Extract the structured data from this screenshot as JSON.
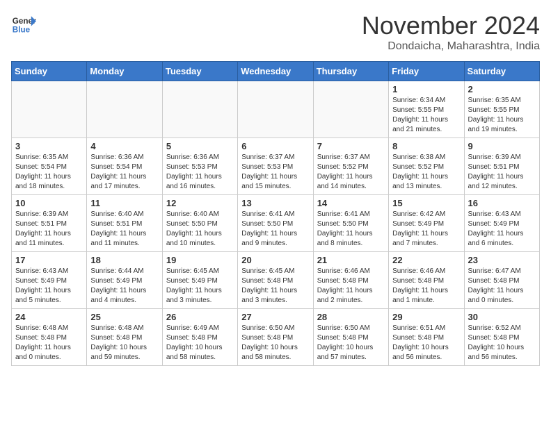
{
  "logo": {
    "line1": "General",
    "line2": "Blue"
  },
  "title": "November 2024",
  "location": "Dondaicha, Maharashtra, India",
  "weekdays": [
    "Sunday",
    "Monday",
    "Tuesday",
    "Wednesday",
    "Thursday",
    "Friday",
    "Saturday"
  ],
  "weeks": [
    [
      {
        "day": "",
        "info": ""
      },
      {
        "day": "",
        "info": ""
      },
      {
        "day": "",
        "info": ""
      },
      {
        "day": "",
        "info": ""
      },
      {
        "day": "",
        "info": ""
      },
      {
        "day": "1",
        "info": "Sunrise: 6:34 AM\nSunset: 5:55 PM\nDaylight: 11 hours and 21 minutes."
      },
      {
        "day": "2",
        "info": "Sunrise: 6:35 AM\nSunset: 5:55 PM\nDaylight: 11 hours and 19 minutes."
      }
    ],
    [
      {
        "day": "3",
        "info": "Sunrise: 6:35 AM\nSunset: 5:54 PM\nDaylight: 11 hours and 18 minutes."
      },
      {
        "day": "4",
        "info": "Sunrise: 6:36 AM\nSunset: 5:54 PM\nDaylight: 11 hours and 17 minutes."
      },
      {
        "day": "5",
        "info": "Sunrise: 6:36 AM\nSunset: 5:53 PM\nDaylight: 11 hours and 16 minutes."
      },
      {
        "day": "6",
        "info": "Sunrise: 6:37 AM\nSunset: 5:53 PM\nDaylight: 11 hours and 15 minutes."
      },
      {
        "day": "7",
        "info": "Sunrise: 6:37 AM\nSunset: 5:52 PM\nDaylight: 11 hours and 14 minutes."
      },
      {
        "day": "8",
        "info": "Sunrise: 6:38 AM\nSunset: 5:52 PM\nDaylight: 11 hours and 13 minutes."
      },
      {
        "day": "9",
        "info": "Sunrise: 6:39 AM\nSunset: 5:51 PM\nDaylight: 11 hours and 12 minutes."
      }
    ],
    [
      {
        "day": "10",
        "info": "Sunrise: 6:39 AM\nSunset: 5:51 PM\nDaylight: 11 hours and 11 minutes."
      },
      {
        "day": "11",
        "info": "Sunrise: 6:40 AM\nSunset: 5:51 PM\nDaylight: 11 hours and 11 minutes."
      },
      {
        "day": "12",
        "info": "Sunrise: 6:40 AM\nSunset: 5:50 PM\nDaylight: 11 hours and 10 minutes."
      },
      {
        "day": "13",
        "info": "Sunrise: 6:41 AM\nSunset: 5:50 PM\nDaylight: 11 hours and 9 minutes."
      },
      {
        "day": "14",
        "info": "Sunrise: 6:41 AM\nSunset: 5:50 PM\nDaylight: 11 hours and 8 minutes."
      },
      {
        "day": "15",
        "info": "Sunrise: 6:42 AM\nSunset: 5:49 PM\nDaylight: 11 hours and 7 minutes."
      },
      {
        "day": "16",
        "info": "Sunrise: 6:43 AM\nSunset: 5:49 PM\nDaylight: 11 hours and 6 minutes."
      }
    ],
    [
      {
        "day": "17",
        "info": "Sunrise: 6:43 AM\nSunset: 5:49 PM\nDaylight: 11 hours and 5 minutes."
      },
      {
        "day": "18",
        "info": "Sunrise: 6:44 AM\nSunset: 5:49 PM\nDaylight: 11 hours and 4 minutes."
      },
      {
        "day": "19",
        "info": "Sunrise: 6:45 AM\nSunset: 5:49 PM\nDaylight: 11 hours and 3 minutes."
      },
      {
        "day": "20",
        "info": "Sunrise: 6:45 AM\nSunset: 5:48 PM\nDaylight: 11 hours and 3 minutes."
      },
      {
        "day": "21",
        "info": "Sunrise: 6:46 AM\nSunset: 5:48 PM\nDaylight: 11 hours and 2 minutes."
      },
      {
        "day": "22",
        "info": "Sunrise: 6:46 AM\nSunset: 5:48 PM\nDaylight: 11 hours and 1 minute."
      },
      {
        "day": "23",
        "info": "Sunrise: 6:47 AM\nSunset: 5:48 PM\nDaylight: 11 hours and 0 minutes."
      }
    ],
    [
      {
        "day": "24",
        "info": "Sunrise: 6:48 AM\nSunset: 5:48 PM\nDaylight: 11 hours and 0 minutes."
      },
      {
        "day": "25",
        "info": "Sunrise: 6:48 AM\nSunset: 5:48 PM\nDaylight: 10 hours and 59 minutes."
      },
      {
        "day": "26",
        "info": "Sunrise: 6:49 AM\nSunset: 5:48 PM\nDaylight: 10 hours and 58 minutes."
      },
      {
        "day": "27",
        "info": "Sunrise: 6:50 AM\nSunset: 5:48 PM\nDaylight: 10 hours and 58 minutes."
      },
      {
        "day": "28",
        "info": "Sunrise: 6:50 AM\nSunset: 5:48 PM\nDaylight: 10 hours and 57 minutes."
      },
      {
        "day": "29",
        "info": "Sunrise: 6:51 AM\nSunset: 5:48 PM\nDaylight: 10 hours and 56 minutes."
      },
      {
        "day": "30",
        "info": "Sunrise: 6:52 AM\nSunset: 5:48 PM\nDaylight: 10 hours and 56 minutes."
      }
    ]
  ]
}
